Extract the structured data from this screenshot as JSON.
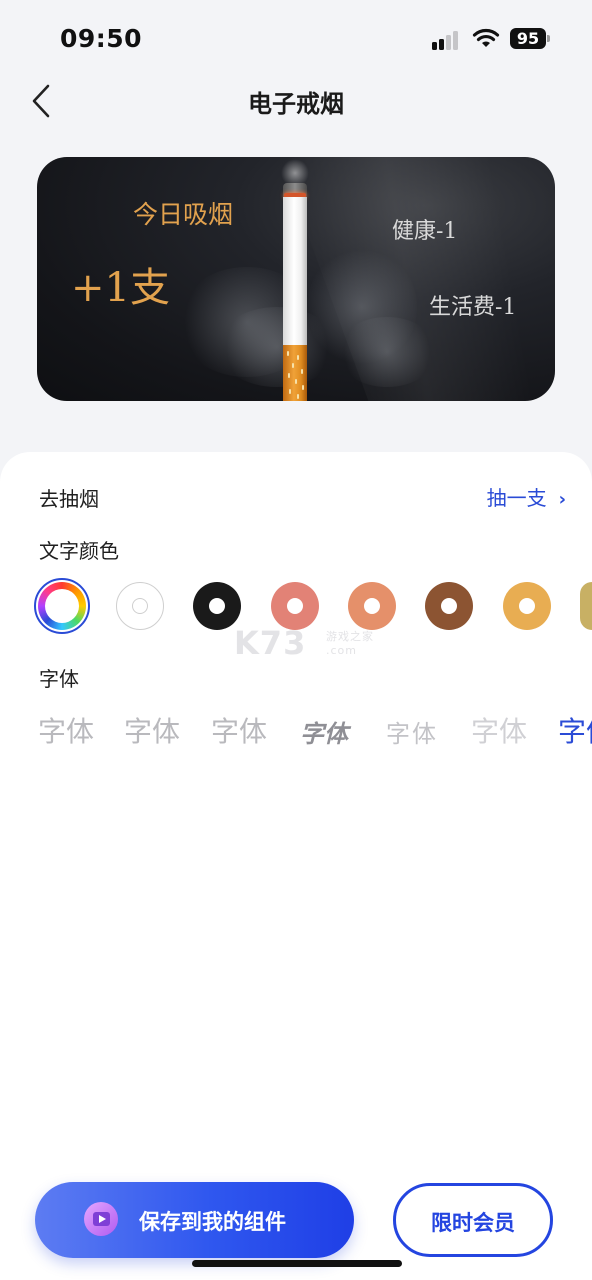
{
  "status_bar": {
    "time": "09:50",
    "battery": "95"
  },
  "header": {
    "title": "电子戒烟"
  },
  "preview": {
    "today_label": "今日吸烟",
    "count": "+1支",
    "health": "健康-1",
    "living_cost": "生活费-1",
    "text_color": "#e2a24e",
    "stat_color": "#d9d9d9"
  },
  "settings": {
    "smoke_row": {
      "label": "去抽烟",
      "action": "抽一支"
    },
    "color_section": {
      "label": "文字颜色",
      "selected_index": 0,
      "swatches": [
        {
          "name": "rainbow",
          "color": "multicolor"
        },
        {
          "name": "white",
          "color": "#ffffff"
        },
        {
          "name": "black",
          "color": "#1a1a1a"
        },
        {
          "name": "salmon",
          "color": "#e28276"
        },
        {
          "name": "peach",
          "color": "#e5906a"
        },
        {
          "name": "brown",
          "color": "#8c5432"
        },
        {
          "name": "amber",
          "color": "#e8ad52"
        },
        {
          "name": "khaki",
          "color": "#c8b064"
        }
      ]
    },
    "font_section": {
      "label": "字体",
      "samples": [
        "字体",
        "字体",
        "字体",
        "字体",
        "字体",
        "字体",
        "字体"
      ],
      "selected_color": "#2a4bd6"
    }
  },
  "watermark": {
    "brand": "K73",
    "sub": "游戏之家",
    "domain": ".com"
  },
  "actions": {
    "save": "保存到我的组件",
    "vip": "限时会员"
  },
  "accent_color": "#2a4bd6"
}
